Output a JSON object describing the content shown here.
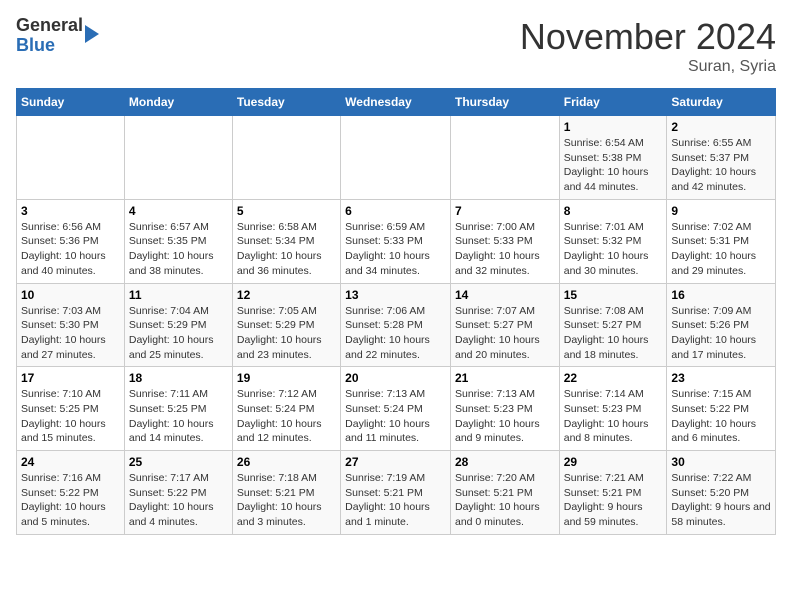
{
  "header": {
    "logo_line1": "General",
    "logo_line2": "Blue",
    "month": "November 2024",
    "location": "Suran, Syria"
  },
  "weekdays": [
    "Sunday",
    "Monday",
    "Tuesday",
    "Wednesday",
    "Thursday",
    "Friday",
    "Saturday"
  ],
  "weeks": [
    [
      {
        "day": "",
        "detail": ""
      },
      {
        "day": "",
        "detail": ""
      },
      {
        "day": "",
        "detail": ""
      },
      {
        "day": "",
        "detail": ""
      },
      {
        "day": "",
        "detail": ""
      },
      {
        "day": "1",
        "detail": "Sunrise: 6:54 AM\nSunset: 5:38 PM\nDaylight: 10 hours and 44 minutes."
      },
      {
        "day": "2",
        "detail": "Sunrise: 6:55 AM\nSunset: 5:37 PM\nDaylight: 10 hours and 42 minutes."
      }
    ],
    [
      {
        "day": "3",
        "detail": "Sunrise: 6:56 AM\nSunset: 5:36 PM\nDaylight: 10 hours and 40 minutes."
      },
      {
        "day": "4",
        "detail": "Sunrise: 6:57 AM\nSunset: 5:35 PM\nDaylight: 10 hours and 38 minutes."
      },
      {
        "day": "5",
        "detail": "Sunrise: 6:58 AM\nSunset: 5:34 PM\nDaylight: 10 hours and 36 minutes."
      },
      {
        "day": "6",
        "detail": "Sunrise: 6:59 AM\nSunset: 5:33 PM\nDaylight: 10 hours and 34 minutes."
      },
      {
        "day": "7",
        "detail": "Sunrise: 7:00 AM\nSunset: 5:33 PM\nDaylight: 10 hours and 32 minutes."
      },
      {
        "day": "8",
        "detail": "Sunrise: 7:01 AM\nSunset: 5:32 PM\nDaylight: 10 hours and 30 minutes."
      },
      {
        "day": "9",
        "detail": "Sunrise: 7:02 AM\nSunset: 5:31 PM\nDaylight: 10 hours and 29 minutes."
      }
    ],
    [
      {
        "day": "10",
        "detail": "Sunrise: 7:03 AM\nSunset: 5:30 PM\nDaylight: 10 hours and 27 minutes."
      },
      {
        "day": "11",
        "detail": "Sunrise: 7:04 AM\nSunset: 5:29 PM\nDaylight: 10 hours and 25 minutes."
      },
      {
        "day": "12",
        "detail": "Sunrise: 7:05 AM\nSunset: 5:29 PM\nDaylight: 10 hours and 23 minutes."
      },
      {
        "day": "13",
        "detail": "Sunrise: 7:06 AM\nSunset: 5:28 PM\nDaylight: 10 hours and 22 minutes."
      },
      {
        "day": "14",
        "detail": "Sunrise: 7:07 AM\nSunset: 5:27 PM\nDaylight: 10 hours and 20 minutes."
      },
      {
        "day": "15",
        "detail": "Sunrise: 7:08 AM\nSunset: 5:27 PM\nDaylight: 10 hours and 18 minutes."
      },
      {
        "day": "16",
        "detail": "Sunrise: 7:09 AM\nSunset: 5:26 PM\nDaylight: 10 hours and 17 minutes."
      }
    ],
    [
      {
        "day": "17",
        "detail": "Sunrise: 7:10 AM\nSunset: 5:25 PM\nDaylight: 10 hours and 15 minutes."
      },
      {
        "day": "18",
        "detail": "Sunrise: 7:11 AM\nSunset: 5:25 PM\nDaylight: 10 hours and 14 minutes."
      },
      {
        "day": "19",
        "detail": "Sunrise: 7:12 AM\nSunset: 5:24 PM\nDaylight: 10 hours and 12 minutes."
      },
      {
        "day": "20",
        "detail": "Sunrise: 7:13 AM\nSunset: 5:24 PM\nDaylight: 10 hours and 11 minutes."
      },
      {
        "day": "21",
        "detail": "Sunrise: 7:13 AM\nSunset: 5:23 PM\nDaylight: 10 hours and 9 minutes."
      },
      {
        "day": "22",
        "detail": "Sunrise: 7:14 AM\nSunset: 5:23 PM\nDaylight: 10 hours and 8 minutes."
      },
      {
        "day": "23",
        "detail": "Sunrise: 7:15 AM\nSunset: 5:22 PM\nDaylight: 10 hours and 6 minutes."
      }
    ],
    [
      {
        "day": "24",
        "detail": "Sunrise: 7:16 AM\nSunset: 5:22 PM\nDaylight: 10 hours and 5 minutes."
      },
      {
        "day": "25",
        "detail": "Sunrise: 7:17 AM\nSunset: 5:22 PM\nDaylight: 10 hours and 4 minutes."
      },
      {
        "day": "26",
        "detail": "Sunrise: 7:18 AM\nSunset: 5:21 PM\nDaylight: 10 hours and 3 minutes."
      },
      {
        "day": "27",
        "detail": "Sunrise: 7:19 AM\nSunset: 5:21 PM\nDaylight: 10 hours and 1 minute."
      },
      {
        "day": "28",
        "detail": "Sunrise: 7:20 AM\nSunset: 5:21 PM\nDaylight: 10 hours and 0 minutes."
      },
      {
        "day": "29",
        "detail": "Sunrise: 7:21 AM\nSunset: 5:21 PM\nDaylight: 9 hours and 59 minutes."
      },
      {
        "day": "30",
        "detail": "Sunrise: 7:22 AM\nSunset: 5:20 PM\nDaylight: 9 hours and 58 minutes."
      }
    ]
  ]
}
